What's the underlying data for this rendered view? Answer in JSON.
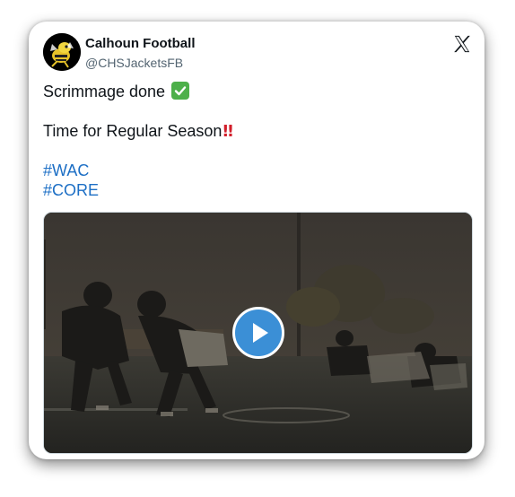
{
  "author": {
    "display_name": "Calhoun Football",
    "handle": "@CHSJacketsFB",
    "avatar_icon": "yellow-jacket-mascot-icon"
  },
  "platform_icon": "x-logo-icon",
  "tweet": {
    "line1": "Scrimmage done",
    "line1_emoji": "check-mark-button",
    "line2": "Time for Regular Season",
    "line2_emoji": "‼",
    "hashtags": [
      "#WAC",
      "#CORE"
    ]
  },
  "media": {
    "type": "video",
    "play_icon": "play-icon"
  },
  "colors": {
    "hashtag": "#1d6fc5",
    "play_button": "#3b8fd6",
    "check_emoji": "#4db04a",
    "bangbang": "#d21f2b"
  }
}
